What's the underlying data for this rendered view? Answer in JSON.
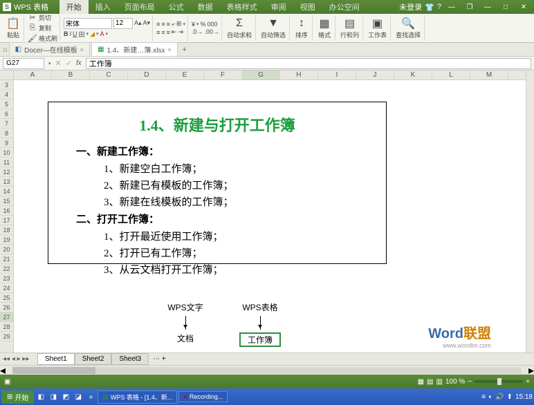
{
  "titlebar": {
    "app_prefix": "S",
    "app_name": "WPS 表格",
    "login": "未登录",
    "tabs": [
      "开始",
      "插入",
      "页面布局",
      "公式",
      "数据",
      "表格样式",
      "审阅",
      "视图",
      "办公空间"
    ]
  },
  "ribbon": {
    "paste": "粘贴",
    "cut": "剪切",
    "copy": "复制",
    "fmtpaint": "格式刷",
    "font_name": "宋体",
    "font_size": "12",
    "autosum": "自动求和",
    "autofilter": "自动筛选",
    "sort": "排序",
    "format": "格式",
    "rowcol": "行和列",
    "worksheet": "工作表",
    "findsel": "查找选择"
  },
  "doctabs": {
    "tab1": "Docer—在线模板",
    "tab2": "1.4、新建…簿.xlsx"
  },
  "formula": {
    "name": "G27",
    "value": "工作簿"
  },
  "columns": [
    "A",
    "B",
    "C",
    "D",
    "E",
    "F",
    "G",
    "H",
    "I",
    "J",
    "K",
    "L",
    "M"
  ],
  "rows": [
    "3",
    "4",
    "5",
    "6",
    "7",
    "8",
    "9",
    "10",
    "11",
    "12",
    "13",
    "14",
    "15",
    "16",
    "17",
    "18",
    "19",
    "20",
    "21",
    "22",
    "23",
    "24",
    "25",
    "26",
    "27",
    "28",
    "29"
  ],
  "content": {
    "title": "1.4、新建与打开工作簿",
    "h1": "一、新建工作簿：",
    "i1": "1、新建空白工作簿；",
    "i2": "2、新建已有模板的工作簿；",
    "i3": "3、新建在线模板的工作簿；",
    "h2": "二、打开工作簿：",
    "i4": "1、打开最近使用工作簿；",
    "i5": "2、打开已有工作簿；",
    "i6": "3、从云文档打开工作簿；"
  },
  "labels": {
    "l1_top": "WPS文字",
    "l1_bot": "文档",
    "l2_top": "WPS表格",
    "l2_bot": "工作簿"
  },
  "watermark": {
    "w1": "Word",
    "w2": "联盟",
    "url": "www.wordlm.com"
  },
  "sheets": [
    "Sheet1",
    "Sheet2",
    "Sheet3"
  ],
  "status": {
    "zoom": "100 %"
  },
  "taskbar": {
    "start": "开始",
    "item1": "WPS 表格 - [1.4、新...",
    "item2": "Recording...",
    "time": "15:18"
  }
}
